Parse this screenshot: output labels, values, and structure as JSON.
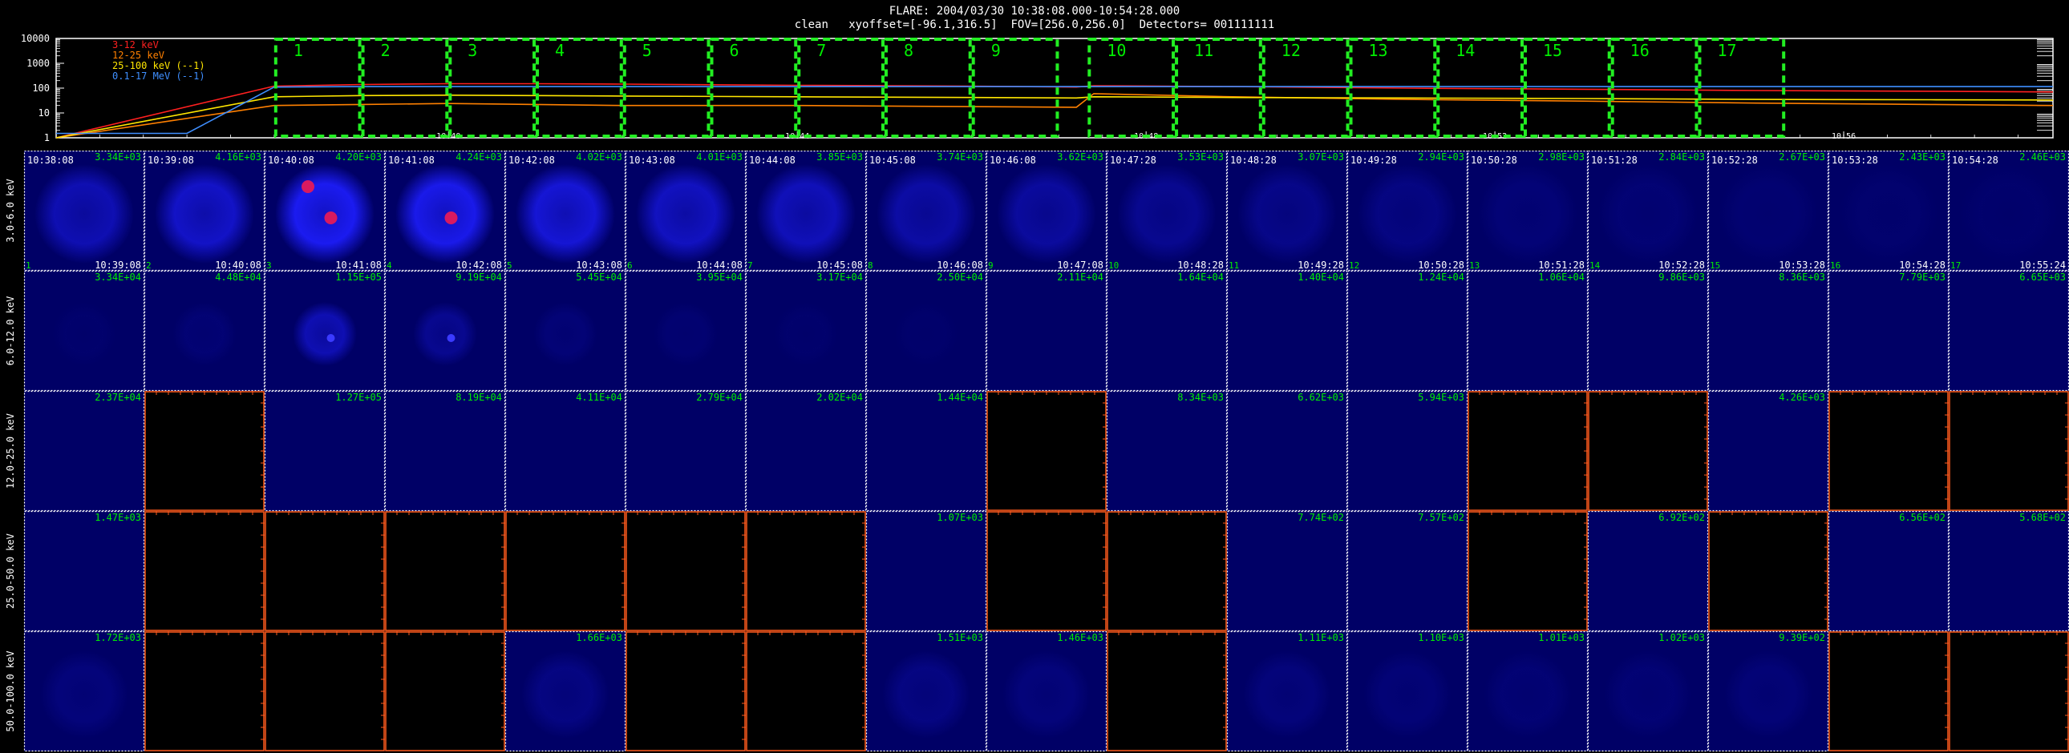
{
  "header": {
    "title": "FLARE: 2004/03/30 10:38:08.000-10:54:28.000",
    "subtitle": "clean   xyoffset=[-96.1,316.5]  FOV=[256.0,256.0]  Detectors= 001111111"
  },
  "colors": {
    "band_3_12": "#ff2020",
    "band_12_25": "#ff8000",
    "band_25_100": "#ffe600",
    "band_01_17": "#3f8fff",
    "interval_box": "#22ee22",
    "label_green": "#00ee00",
    "empty_axis": "#ff5a1e",
    "image_bg": "#000066",
    "source_blue": "#1b1bf0",
    "source_peak": "#d81a60"
  },
  "chart_data": [
    {
      "type": "line",
      "title": "",
      "ylim": [
        1,
        10000
      ],
      "y_scale": "log",
      "y_ticks": [
        "10000",
        "1000",
        "100",
        "10",
        "1"
      ],
      "x_ticks": [
        "10:40",
        "10:44",
        "10:48",
        "10:52",
        "10:56"
      ],
      "x_tick_minutes": [
        2,
        6,
        10,
        14,
        18
      ],
      "x_range_minutes": [
        -2.5,
        20.4
      ],
      "legend": [
        "3-12 keV",
        "12-25 keV",
        "25-100 keV (--1)",
        "0.1-17 MeV (--1)"
      ],
      "legend_placement": "top-left",
      "series": [
        {
          "name": "3-12 keV",
          "x": [
            -2.5,
            0,
            1,
            2,
            3,
            4,
            6,
            8,
            9.2,
            9.4,
            11,
            13,
            15,
            17,
            19,
            20.4
          ],
          "y": [
            1,
            120,
            140,
            150,
            150,
            145,
            130,
            120,
            110,
            125,
            115,
            100,
            90,
            80,
            75,
            70
          ]
        },
        {
          "name": "12-25 keV",
          "x": [
            -2.5,
            0,
            1,
            2,
            3,
            4,
            6,
            8,
            9.2,
            9.4,
            11,
            13,
            15,
            17,
            19,
            20.4
          ],
          "y": [
            1,
            20,
            22,
            24,
            22,
            20,
            20,
            18,
            17,
            60,
            45,
            35,
            30,
            25,
            22,
            20
          ]
        },
        {
          "name": "25-100 keV (--1)",
          "x": [
            -2.5,
            0,
            1,
            2,
            3,
            4,
            6,
            8,
            9.2,
            9.4,
            11,
            13,
            15,
            17,
            19,
            20.4
          ],
          "y": [
            1,
            45,
            50,
            52,
            50,
            48,
            45,
            42,
            40,
            45,
            42,
            40,
            38,
            35,
            34,
            33
          ]
        },
        {
          "name": "0.1-17 MeV (--1)",
          "x": [
            -2.5,
            -1,
            0,
            1,
            2,
            4,
            6,
            8,
            10,
            12,
            14,
            16,
            18,
            20.4
          ],
          "y": [
            1.5,
            1.5,
            110,
            115,
            115,
            115,
            115,
            115,
            115,
            115,
            115,
            115,
            115,
            115
          ]
        }
      ],
      "intervals": [
        "1",
        "2",
        "3",
        "4",
        "5",
        "6",
        "7",
        "8",
        "9",
        "10",
        "11",
        "12",
        "13",
        "14",
        "15",
        "16",
        "17"
      ],
      "interval_start_minutes": [
        0,
        1,
        2,
        3,
        4,
        5,
        6,
        7,
        8,
        9.33,
        10.33,
        11.33,
        12.33,
        13.33,
        14.33,
        15.33,
        16.33
      ]
    },
    {
      "type": "heatmap",
      "row_labels": [
        "3.0-6.0 keV",
        "6.0-12.0 keV",
        "12.0-25.0 keV",
        "25.0-50.0 keV",
        "50.0-100.0 keV"
      ],
      "time_start": [
        "10:38:08",
        "10:39:08",
        "10:40:08",
        "10:41:08",
        "10:42:08",
        "10:43:08",
        "10:44:08",
        "10:45:08",
        "10:46:08",
        "10:47:28",
        "10:48:28",
        "10:49:28",
        "10:50:28",
        "10:51:28",
        "10:52:28",
        "10:53:28",
        "10:54:28"
      ],
      "time_end": [
        "10:39:08",
        "10:40:08",
        "10:41:08",
        "10:42:08",
        "10:43:08",
        "10:44:08",
        "10:45:08",
        "10:46:08",
        "10:47:08",
        "10:48:28",
        "10:49:28",
        "10:50:28",
        "10:51:28",
        "10:52:28",
        "10:53:28",
        "10:54:28",
        "10:55:24"
      ],
      "interval_numbers": [
        "1",
        "2",
        "3",
        "4",
        "5",
        "6",
        "7",
        "8",
        "9",
        "10",
        "11",
        "12",
        "13",
        "14",
        "15",
        "16",
        "17"
      ],
      "peaks": [
        [
          "3.34E+03",
          "4.16E+03",
          "4.20E+03",
          "4.24E+03",
          "4.02E+03",
          "4.01E+03",
          "3.85E+03",
          "3.74E+03",
          "3.62E+03",
          "3.53E+03",
          "3.07E+03",
          "2.94E+03",
          "2.98E+03",
          "2.84E+03",
          "2.67E+03",
          "2.43E+03",
          "2.46E+03"
        ],
        [
          "3.34E+04",
          "4.48E+04",
          "1.15E+05",
          "9.19E+04",
          "5.45E+04",
          "3.95E+04",
          "3.17E+04",
          "2.50E+04",
          "2.11E+04",
          "1.64E+04",
          "1.40E+04",
          "1.24E+04",
          "1.06E+04",
          "9.86E+03",
          "8.36E+03",
          "7.79E+03",
          "6.65E+03"
        ],
        [
          "2.37E+04",
          "",
          "1.27E+05",
          "8.19E+04",
          "4.11E+04",
          "2.79E+04",
          "2.02E+04",
          "1.44E+04",
          "",
          "8.34E+03",
          "6.62E+03",
          "5.94E+03",
          "",
          "",
          "4.26E+03",
          "",
          ""
        ],
        [
          "1.47E+03",
          "",
          "",
          "",
          "",
          "",
          "",
          "1.07E+03",
          "",
          "",
          "7.74E+02",
          "7.57E+02",
          "",
          "6.92E+02",
          "",
          "6.56E+02",
          "5.68E+02"
        ],
        [
          "1.72E+03",
          "",
          "",
          "",
          "1.66E+03",
          "",
          "",
          "1.51E+03",
          "1.46E+03",
          "",
          "1.11E+03",
          "1.10E+03",
          "1.01E+03",
          "1.02E+03",
          "9.39E+02",
          "",
          ""
        ]
      ],
      "intensity": [
        [
          0.55,
          0.7,
          1.0,
          0.95,
          0.8,
          0.65,
          0.6,
          0.45,
          0.4,
          0.3,
          0.25,
          0.2,
          0.12,
          0.1,
          0.08,
          0.06,
          0.05
        ],
        [
          0.05,
          0.1,
          0.55,
          0.3,
          0.12,
          0.08,
          0.05,
          0.04,
          0.03,
          0.03,
          0.03,
          0.02,
          0.02,
          0.02,
          0.02,
          0.02,
          0.02
        ],
        [
          0.02,
          0,
          0.03,
          0.02,
          0.02,
          0.02,
          0.02,
          0.02,
          0,
          0.02,
          0.02,
          0.02,
          0,
          0,
          0.02,
          0,
          0
        ],
        [
          0.02,
          0,
          0,
          0,
          0,
          0,
          0,
          0.02,
          0,
          0,
          0.02,
          0.02,
          0,
          0.02,
          0,
          0.02,
          0.02
        ],
        [
          0.15,
          0,
          0,
          0,
          0.2,
          0,
          0,
          0.2,
          0.15,
          0,
          0.15,
          0.12,
          0.1,
          0.1,
          0.12,
          0,
          0
        ]
      ],
      "source_peaks": [
        [],
        [],
        [
          1,
          2
        ],
        [
          1
        ],
        [],
        [],
        [],
        [],
        [],
        [],
        [],
        [],
        [],
        [],
        [],
        [],
        []
      ]
    }
  ]
}
